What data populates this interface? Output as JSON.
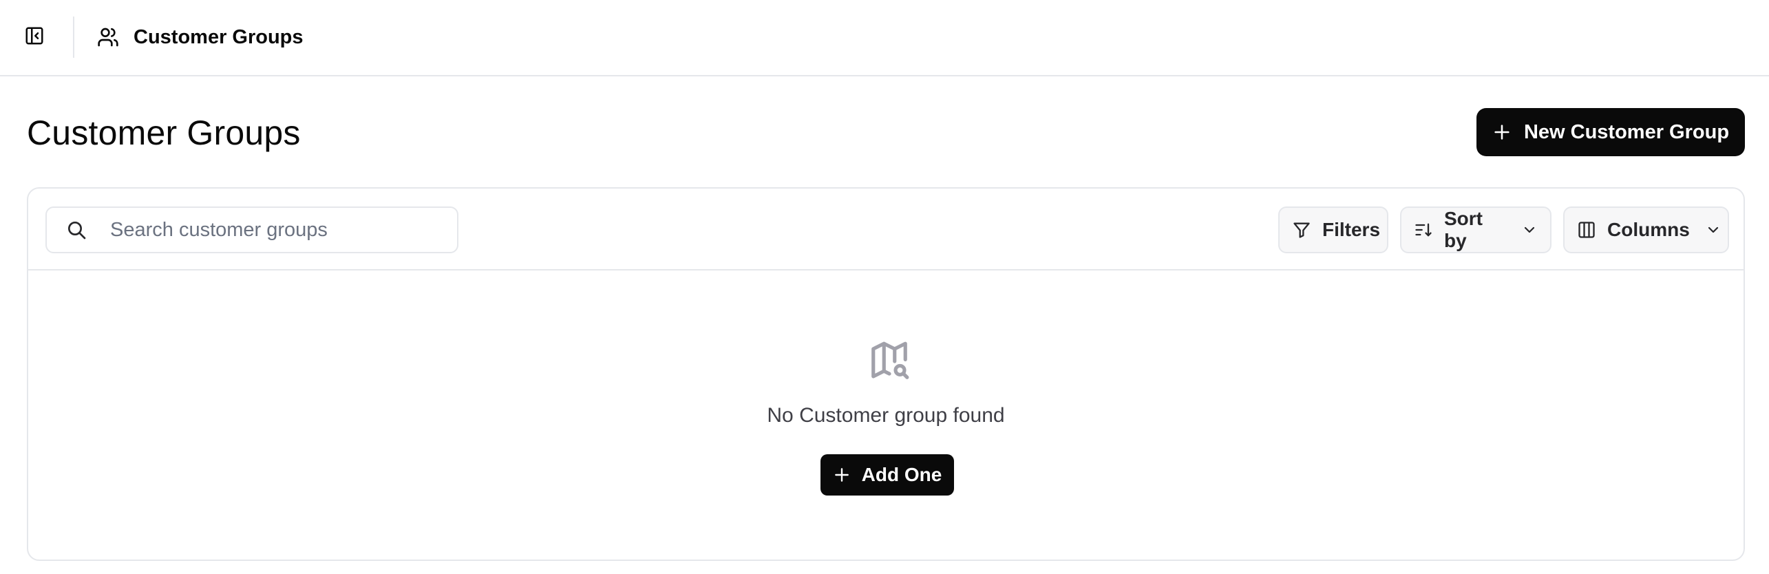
{
  "topbar": {
    "sidebar_toggle_icon": "panel-left-icon",
    "breadcrumb_icon": "users-icon",
    "breadcrumb_label": "Customer Groups"
  },
  "page": {
    "title": "Customer Groups",
    "new_button_label": "New Customer Group",
    "new_button_icon": "plus-icon"
  },
  "toolbar": {
    "search_placeholder": "Search customer groups",
    "search_value": "",
    "filters_label": "Filters",
    "sort_label": "Sort by",
    "columns_label": "Columns"
  },
  "empty_state": {
    "icon": "map-search-icon",
    "message": "No Customer group found",
    "add_label": "Add One"
  },
  "colors": {
    "primary": "#0a0a0a",
    "border": "#e5e7eb",
    "muted_text": "#6b7280",
    "icon_muted": "#a1a1aa"
  }
}
